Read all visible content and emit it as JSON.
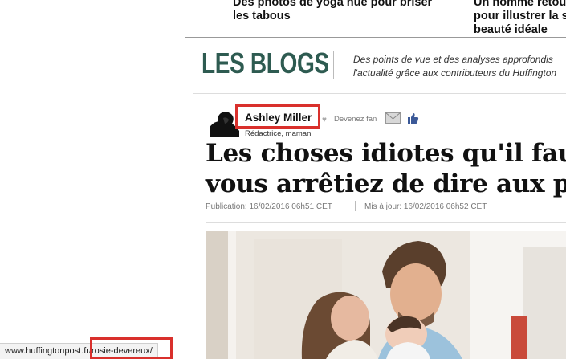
{
  "related": [
    {
      "title": "Des photos de yoga nue pour briser les tabous"
    },
    {
      "title": "Un homme retouche pour illustrer la su beauté idéale"
    }
  ],
  "blogs": {
    "logo": "LES BLOGS",
    "tagline_line1": "Des points de vue et des analyses approfondis",
    "tagline_line2": "l'actualité grâce aux contributeurs du Huffington"
  },
  "author": {
    "name": "Ashley Miller",
    "role": "Rédactrice, maman",
    "fan_label": "Devenez fan"
  },
  "article": {
    "headline_line1": "Les choses idiotes qu'il faut",
    "headline_line2": "vous arrêtiez de dire aux pa",
    "published": "Publication: 16/02/2016 06h51 CET",
    "updated": "Mis à jour: 16/02/2016 06h52 CET"
  },
  "status_bar": {
    "url": "www.huffingtonpost.fr/rosie-devereux/"
  },
  "colors": {
    "brand_green": "#2e5b51",
    "highlight_red": "#d9302c",
    "facebook_blue": "#3b5998"
  },
  "icons": [
    "heart-icon",
    "mail-icon",
    "facebook-like-icon",
    "author-avatar"
  ]
}
